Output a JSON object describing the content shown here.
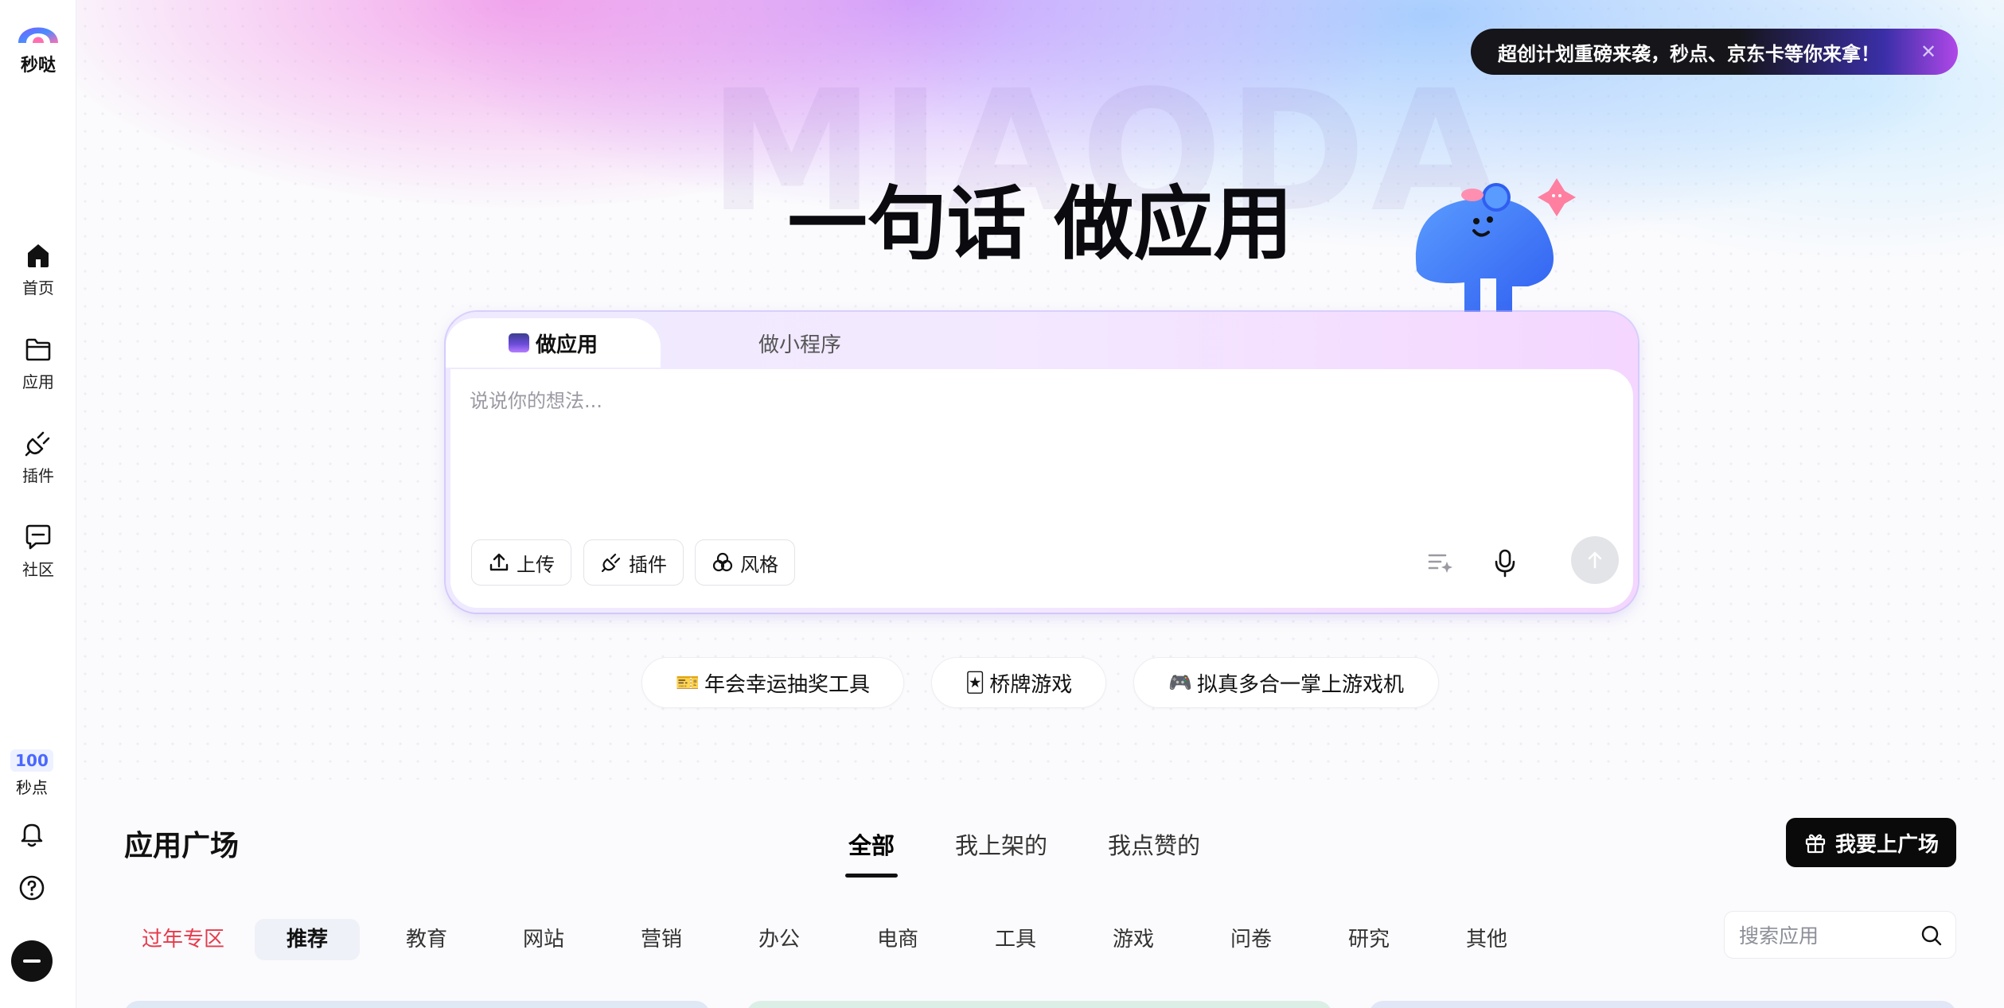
{
  "brand": {
    "name": "秒哒",
    "watermark": "MIAODA"
  },
  "sidebar": {
    "items": [
      {
        "label": "首页",
        "icon": "home-icon"
      },
      {
        "label": "应用",
        "icon": "folder-icon"
      },
      {
        "label": "插件",
        "icon": "plug-icon"
      },
      {
        "label": "社区",
        "icon": "chat-icon"
      }
    ],
    "points": {
      "value": "100",
      "label": "秒点"
    }
  },
  "announcement": {
    "text": "超创计划重磅来袭，秒点、京东卡等你来拿！"
  },
  "hero": {
    "title": "一句话 做应用"
  },
  "composer": {
    "tabs": [
      {
        "label": "做应用"
      },
      {
        "label": "做小程序"
      }
    ],
    "placeholder": "说说你的想法...",
    "tools": [
      {
        "label": "上传"
      },
      {
        "label": "插件"
      },
      {
        "label": "风格"
      }
    ]
  },
  "suggestions": [
    {
      "icon": "🎫",
      "label": "年会幸运抽奖工具"
    },
    {
      "icon": "🃏",
      "label": "桥牌游戏"
    },
    {
      "icon": "🎮",
      "label": "拟真多合一掌上游戏机"
    }
  ],
  "plaza": {
    "title": "应用广场",
    "tabs": [
      {
        "label": "全部"
      },
      {
        "label": "我上架的"
      },
      {
        "label": "我点赞的"
      }
    ],
    "publish_label": "我要上广场",
    "categories": [
      {
        "label": "过年专区"
      },
      {
        "label": "推荐"
      },
      {
        "label": "教育"
      },
      {
        "label": "网站"
      },
      {
        "label": "营销"
      },
      {
        "label": "办公"
      },
      {
        "label": "电商"
      },
      {
        "label": "工具"
      },
      {
        "label": "游戏"
      },
      {
        "label": "问卷"
      },
      {
        "label": "研究"
      },
      {
        "label": "其他"
      }
    ],
    "search_placeholder": "搜索应用"
  },
  "colors": {
    "accent": "#4a68ff",
    "special_category": "#e63a4b",
    "primary_button": "#0a0a0a"
  }
}
